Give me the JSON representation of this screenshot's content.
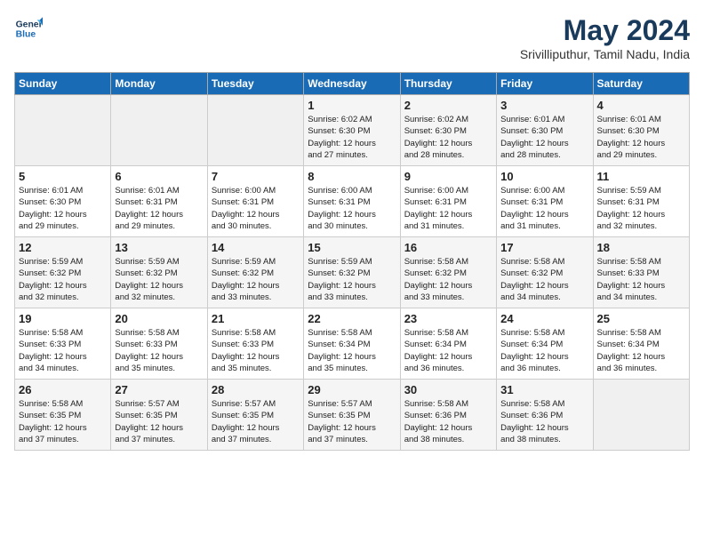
{
  "header": {
    "logo_line1": "General",
    "logo_line2": "Blue",
    "month": "May 2024",
    "location": "Srivilliputhur, Tamil Nadu, India"
  },
  "days_of_week": [
    "Sunday",
    "Monday",
    "Tuesday",
    "Wednesday",
    "Thursday",
    "Friday",
    "Saturday"
  ],
  "weeks": [
    [
      {
        "day": "",
        "info": ""
      },
      {
        "day": "",
        "info": ""
      },
      {
        "day": "",
        "info": ""
      },
      {
        "day": "1",
        "info": "Sunrise: 6:02 AM\nSunset: 6:30 PM\nDaylight: 12 hours\nand 27 minutes."
      },
      {
        "day": "2",
        "info": "Sunrise: 6:02 AM\nSunset: 6:30 PM\nDaylight: 12 hours\nand 28 minutes."
      },
      {
        "day": "3",
        "info": "Sunrise: 6:01 AM\nSunset: 6:30 PM\nDaylight: 12 hours\nand 28 minutes."
      },
      {
        "day": "4",
        "info": "Sunrise: 6:01 AM\nSunset: 6:30 PM\nDaylight: 12 hours\nand 29 minutes."
      }
    ],
    [
      {
        "day": "5",
        "info": "Sunrise: 6:01 AM\nSunset: 6:30 PM\nDaylight: 12 hours\nand 29 minutes."
      },
      {
        "day": "6",
        "info": "Sunrise: 6:01 AM\nSunset: 6:31 PM\nDaylight: 12 hours\nand 29 minutes."
      },
      {
        "day": "7",
        "info": "Sunrise: 6:00 AM\nSunset: 6:31 PM\nDaylight: 12 hours\nand 30 minutes."
      },
      {
        "day": "8",
        "info": "Sunrise: 6:00 AM\nSunset: 6:31 PM\nDaylight: 12 hours\nand 30 minutes."
      },
      {
        "day": "9",
        "info": "Sunrise: 6:00 AM\nSunset: 6:31 PM\nDaylight: 12 hours\nand 31 minutes."
      },
      {
        "day": "10",
        "info": "Sunrise: 6:00 AM\nSunset: 6:31 PM\nDaylight: 12 hours\nand 31 minutes."
      },
      {
        "day": "11",
        "info": "Sunrise: 5:59 AM\nSunset: 6:31 PM\nDaylight: 12 hours\nand 32 minutes."
      }
    ],
    [
      {
        "day": "12",
        "info": "Sunrise: 5:59 AM\nSunset: 6:32 PM\nDaylight: 12 hours\nand 32 minutes."
      },
      {
        "day": "13",
        "info": "Sunrise: 5:59 AM\nSunset: 6:32 PM\nDaylight: 12 hours\nand 32 minutes."
      },
      {
        "day": "14",
        "info": "Sunrise: 5:59 AM\nSunset: 6:32 PM\nDaylight: 12 hours\nand 33 minutes."
      },
      {
        "day": "15",
        "info": "Sunrise: 5:59 AM\nSunset: 6:32 PM\nDaylight: 12 hours\nand 33 minutes."
      },
      {
        "day": "16",
        "info": "Sunrise: 5:58 AM\nSunset: 6:32 PM\nDaylight: 12 hours\nand 33 minutes."
      },
      {
        "day": "17",
        "info": "Sunrise: 5:58 AM\nSunset: 6:32 PM\nDaylight: 12 hours\nand 34 minutes."
      },
      {
        "day": "18",
        "info": "Sunrise: 5:58 AM\nSunset: 6:33 PM\nDaylight: 12 hours\nand 34 minutes."
      }
    ],
    [
      {
        "day": "19",
        "info": "Sunrise: 5:58 AM\nSunset: 6:33 PM\nDaylight: 12 hours\nand 34 minutes."
      },
      {
        "day": "20",
        "info": "Sunrise: 5:58 AM\nSunset: 6:33 PM\nDaylight: 12 hours\nand 35 minutes."
      },
      {
        "day": "21",
        "info": "Sunrise: 5:58 AM\nSunset: 6:33 PM\nDaylight: 12 hours\nand 35 minutes."
      },
      {
        "day": "22",
        "info": "Sunrise: 5:58 AM\nSunset: 6:34 PM\nDaylight: 12 hours\nand 35 minutes."
      },
      {
        "day": "23",
        "info": "Sunrise: 5:58 AM\nSunset: 6:34 PM\nDaylight: 12 hours\nand 36 minutes."
      },
      {
        "day": "24",
        "info": "Sunrise: 5:58 AM\nSunset: 6:34 PM\nDaylight: 12 hours\nand 36 minutes."
      },
      {
        "day": "25",
        "info": "Sunrise: 5:58 AM\nSunset: 6:34 PM\nDaylight: 12 hours\nand 36 minutes."
      }
    ],
    [
      {
        "day": "26",
        "info": "Sunrise: 5:58 AM\nSunset: 6:35 PM\nDaylight: 12 hours\nand 37 minutes."
      },
      {
        "day": "27",
        "info": "Sunrise: 5:57 AM\nSunset: 6:35 PM\nDaylight: 12 hours\nand 37 minutes."
      },
      {
        "day": "28",
        "info": "Sunrise: 5:57 AM\nSunset: 6:35 PM\nDaylight: 12 hours\nand 37 minutes."
      },
      {
        "day": "29",
        "info": "Sunrise: 5:57 AM\nSunset: 6:35 PM\nDaylight: 12 hours\nand 37 minutes."
      },
      {
        "day": "30",
        "info": "Sunrise: 5:58 AM\nSunset: 6:36 PM\nDaylight: 12 hours\nand 38 minutes."
      },
      {
        "day": "31",
        "info": "Sunrise: 5:58 AM\nSunset: 6:36 PM\nDaylight: 12 hours\nand 38 minutes."
      },
      {
        "day": "",
        "info": ""
      }
    ]
  ]
}
